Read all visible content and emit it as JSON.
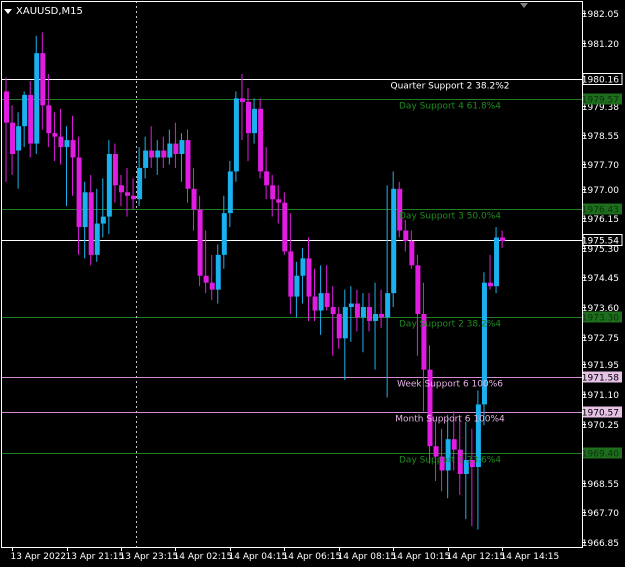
{
  "header": {
    "symbol_label": "XAUUSD,M15"
  },
  "colors": {
    "background": "#000000",
    "bull": "#1ab1ee",
    "bear": "#e21de2",
    "axis_text": "#ffffff",
    "frame": "#ffffff",
    "green_level": "#1e7d1e",
    "green_text": "#1f8c1f",
    "pink_level": "#d28cd2",
    "pink_text": "#e6b4e6",
    "white_level": "#ffffff"
  },
  "chart_data": {
    "type": "candlestick",
    "symbol": "XAUUSD",
    "timeframe": "M15",
    "ylim": [
      1966.7,
      1982.4
    ],
    "y_ticks": [
      1982.05,
      1981.2,
      1980.16,
      1979.38,
      1978.55,
      1977.7,
      1977.0,
      1976.15,
      1975.3,
      1974.45,
      1973.6,
      1972.75,
      1971.95,
      1971.1,
      1970.25,
      1969.4,
      1968.55,
      1967.7,
      1966.85
    ],
    "x_labels": [
      "13 Apr 2022",
      "13 Apr 21:15",
      "13 Apr 23:15",
      "14 Apr 02:15",
      "14 Apr 04:15",
      "14 Apr 06:15",
      "14 Apr 08:15",
      "14 Apr 10:15",
      "14 Apr 12:15",
      "14 Apr 14:15"
    ],
    "x_label_index": [
      1,
      10,
      19,
      28,
      37,
      46,
      55,
      64,
      73,
      82
    ],
    "separator_index": 21.5,
    "levels": [
      {
        "name": "Quarter Support 2 38.2%2",
        "price": 1980.16,
        "price_label": "1980.16",
        "kind": "white",
        "text_color": "#ffffff"
      },
      {
        "name": "Day Support 4 61.8%4",
        "price": 1979.57,
        "price_label": "1979.57",
        "kind": "green",
        "text_color": "#1f8c1f"
      },
      {
        "name": "Day Support 3 50.0%4",
        "price": 1976.43,
        "price_label": "1976.43",
        "kind": "green",
        "text_color": "#1f8c1f"
      },
      {
        "name": "",
        "price": 1975.54,
        "price_label": "1975.54",
        "kind": "white",
        "text_color": "#ffffff"
      },
      {
        "name": "Day Support 2 38.2%4",
        "price": 1973.3,
        "price_label": "1973.30",
        "kind": "green",
        "text_color": "#1f8c1f"
      },
      {
        "name": "Week Support 6 100%6",
        "price": 1971.58,
        "price_label": "1971.58",
        "kind": "pink",
        "text_color": "#e6b4e6"
      },
      {
        "name": "Month Support 6 100%4",
        "price": 1970.57,
        "price_label": "1970.57",
        "kind": "pink",
        "text_color": "#e6b4e6"
      },
      {
        "name": "Day Support 1 23.6%4",
        "price": 1969.4,
        "price_label": "1969.40",
        "kind": "green",
        "text_color": "#1f8c1f"
      }
    ],
    "candles": [
      [
        1979.8,
        1980.2,
        1977.2,
        1978.9
      ],
      [
        1978.9,
        1979.4,
        1977.4,
        1978.0
      ],
      [
        1978.1,
        1979.2,
        1977.0,
        1978.8
      ],
      [
        1978.8,
        1979.8,
        1978.2,
        1979.7
      ],
      [
        1979.7,
        1980.1,
        1977.9,
        1978.3
      ],
      [
        1978.3,
        1981.4,
        1978.0,
        1980.9
      ],
      [
        1980.9,
        1981.5,
        1978.7,
        1979.4
      ],
      [
        1979.4,
        1980.3,
        1978.2,
        1978.6
      ],
      [
        1978.6,
        1979.2,
        1977.8,
        1978.5
      ],
      [
        1978.5,
        1979.3,
        1977.7,
        1978.2
      ],
      [
        1978.2,
        1978.8,
        1976.5,
        1978.4
      ],
      [
        1978.4,
        1979.1,
        1976.8,
        1977.9
      ],
      [
        1977.9,
        1978.5,
        1975.1,
        1975.9
      ],
      [
        1975.9,
        1977.2,
        1975.0,
        1976.9
      ],
      [
        1976.9,
        1977.4,
        1974.8,
        1975.1
      ],
      [
        1975.1,
        1977.0,
        1974.9,
        1976.0
      ],
      [
        1976.0,
        1977.3,
        1975.6,
        1976.2
      ],
      [
        1976.2,
        1978.4,
        1975.7,
        1978.0
      ],
      [
        1978.0,
        1978.3,
        1976.6,
        1977.1
      ],
      [
        1977.1,
        1977.4,
        1976.5,
        1976.9
      ],
      [
        1976.9,
        1977.6,
        1976.2,
        1976.8
      ],
      [
        1976.8,
        1977.3,
        1976.4,
        1976.7
      ],
      [
        1976.7,
        1978.2,
        1976.5,
        1977.6
      ],
      [
        1977.6,
        1978.5,
        1977.3,
        1978.1
      ],
      [
        1978.1,
        1978.8,
        1977.6,
        1977.9
      ],
      [
        1977.9,
        1978.4,
        1977.4,
        1978.1
      ],
      [
        1978.1,
        1978.5,
        1977.6,
        1977.9
      ],
      [
        1977.9,
        1978.7,
        1977.7,
        1978.3
      ],
      [
        1978.3,
        1978.9,
        1977.6,
        1978.0
      ],
      [
        1978.0,
        1978.6,
        1977.2,
        1978.4
      ],
      [
        1978.4,
        1978.7,
        1976.6,
        1977.0
      ],
      [
        1977.0,
        1977.6,
        1975.8,
        1976.4
      ],
      [
        1976.4,
        1976.8,
        1974.2,
        1974.5
      ],
      [
        1974.5,
        1975.8,
        1974.0,
        1974.3
      ],
      [
        1974.3,
        1975.1,
        1973.8,
        1974.1
      ],
      [
        1974.1,
        1975.4,
        1973.7,
        1975.1
      ],
      [
        1975.1,
        1976.8,
        1974.7,
        1976.3
      ],
      [
        1976.3,
        1977.8,
        1975.9,
        1977.5
      ],
      [
        1977.5,
        1979.8,
        1977.2,
        1979.6
      ],
      [
        1979.6,
        1980.3,
        1978.4,
        1979.5
      ],
      [
        1979.5,
        1979.9,
        1977.8,
        1978.6
      ],
      [
        1978.6,
        1979.6,
        1978.3,
        1979.3
      ],
      [
        1979.3,
        1979.6,
        1977.3,
        1977.5
      ],
      [
        1977.5,
        1978.2,
        1976.7,
        1977.1
      ],
      [
        1977.1,
        1977.4,
        1976.2,
        1976.7
      ],
      [
        1976.7,
        1977.1,
        1976.0,
        1976.6
      ],
      [
        1976.6,
        1976.9,
        1975.1,
        1975.2
      ],
      [
        1975.2,
        1976.3,
        1973.4,
        1973.9
      ],
      [
        1973.9,
        1974.9,
        1973.3,
        1974.5
      ],
      [
        1974.5,
        1975.3,
        1973.7,
        1975.0
      ],
      [
        1975.0,
        1975.6,
        1973.2,
        1973.9
      ],
      [
        1973.9,
        1974.7,
        1973.2,
        1973.5
      ],
      [
        1973.5,
        1974.8,
        1972.8,
        1974.0
      ],
      [
        1974.0,
        1974.8,
        1973.5,
        1973.6
      ],
      [
        1973.6,
        1974.2,
        1972.2,
        1973.4
      ],
      [
        1973.4,
        1973.6,
        1972.4,
        1972.7
      ],
      [
        1972.7,
        1974.1,
        1971.5,
        1973.6
      ],
      [
        1973.6,
        1974.2,
        1972.6,
        1973.7
      ],
      [
        1973.7,
        1974.1,
        1972.9,
        1973.3
      ],
      [
        1973.3,
        1974.0,
        1972.3,
        1973.6
      ],
      [
        1973.6,
        1974.0,
        1972.9,
        1973.2
      ],
      [
        1973.2,
        1974.3,
        1971.8,
        1973.4
      ],
      [
        1973.4,
        1974.1,
        1973.0,
        1973.3
      ],
      [
        1973.3,
        1977.1,
        1971.0,
        1974.0
      ],
      [
        1974.0,
        1977.5,
        1973.6,
        1977.0
      ],
      [
        1977.0,
        1977.2,
        1975.6,
        1975.8
      ],
      [
        1975.8,
        1976.1,
        1975.2,
        1975.5
      ],
      [
        1975.5,
        1975.8,
        1974.7,
        1974.8
      ],
      [
        1974.8,
        1975.1,
        1972.2,
        1973.4
      ],
      [
        1973.4,
        1974.3,
        1970.6,
        1971.8
      ],
      [
        1971.8,
        1972.5,
        1969.1,
        1969.6
      ],
      [
        1969.6,
        1970.3,
        1968.6,
        1969.3
      ],
      [
        1969.3,
        1970.1,
        1968.3,
        1968.9
      ],
      [
        1968.9,
        1970.5,
        1968.1,
        1969.8
      ],
      [
        1969.8,
        1970.6,
        1968.9,
        1969.5
      ],
      [
        1969.5,
        1970.4,
        1968.2,
        1968.8
      ],
      [
        1968.8,
        1970.3,
        1967.5,
        1969.2
      ],
      [
        1969.2,
        1970.1,
        1967.3,
        1969.0
      ],
      [
        1969.0,
        1971.2,
        1967.2,
        1970.8
      ],
      [
        1970.8,
        1974.6,
        1970.2,
        1974.3
      ],
      [
        1974.3,
        1975.1,
        1974.1,
        1974.2
      ],
      [
        1974.2,
        1975.9,
        1974.0,
        1975.6
      ],
      [
        1975.6,
        1975.8,
        1975.3,
        1975.5
      ]
    ]
  }
}
